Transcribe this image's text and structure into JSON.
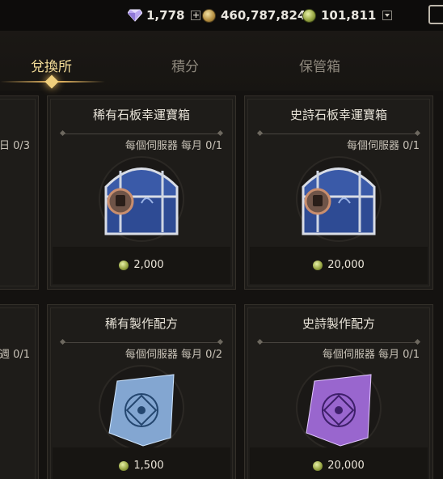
{
  "currency": {
    "diamond": "1,778",
    "gold": "460,787,824",
    "token": "101,811"
  },
  "tabs": [
    "兌換所",
    "積分",
    "保管箱"
  ],
  "left_cards": [
    {
      "limit": "日 0/3"
    },
    {
      "limit": "週 0/1"
    }
  ],
  "cards": [
    {
      "title": "稀有石板幸運寶箱",
      "limit": "每個伺服器 每月 0/1",
      "price": "2,000",
      "icon": "rare-chest-icon"
    },
    {
      "title": "史詩石板幸運寶箱",
      "limit": "每個伺服器 0/1",
      "price": "20,000",
      "icon": "epic-chest-icon"
    },
    {
      "title": "稀有製作配方",
      "limit": "每個伺服器 每月 0/2",
      "price": "1,500",
      "icon": "rare-recipe-icon"
    },
    {
      "title": "史詩製作配方",
      "limit": "每個伺服器 每月 0/1",
      "price": "20,000",
      "icon": "epic-recipe-icon"
    }
  ]
}
